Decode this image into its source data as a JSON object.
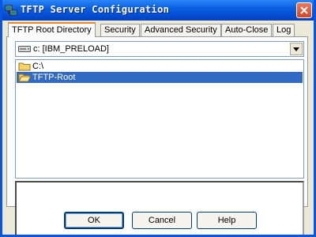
{
  "window": {
    "title": "TFTP Server Configuration"
  },
  "tabs": [
    {
      "label": "TFTP Root Directory",
      "active": true
    },
    {
      "label": "Security",
      "active": false
    },
    {
      "label": "Advanced Security",
      "active": false
    },
    {
      "label": "Auto-Close",
      "active": false
    },
    {
      "label": "Log",
      "active": false
    }
  ],
  "drive": {
    "value": "c: [IBM_PRELOAD]"
  },
  "directories": [
    {
      "label": "C:\\",
      "selected": false
    },
    {
      "label": "TFTP-Root",
      "selected": true
    }
  ],
  "buttons": {
    "ok": "OK",
    "cancel": "Cancel",
    "help": "Help"
  },
  "colors": {
    "title_bar": "#0a5fe0",
    "selection": "#316ac5",
    "tab_highlight": "#e68b2c",
    "close_button": "#d4462a"
  },
  "icons": {
    "app": "network-computer-icon",
    "close": "close-icon",
    "drive": "hard-drive-icon",
    "folder": "folder-icon",
    "dropdown": "chevron-down-icon"
  }
}
